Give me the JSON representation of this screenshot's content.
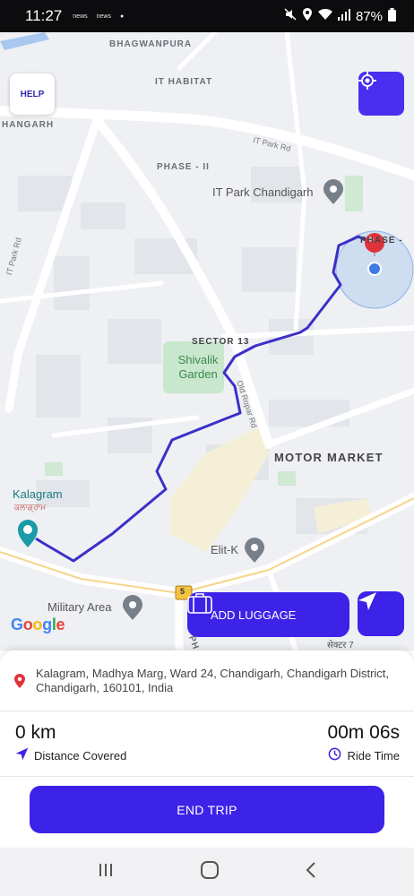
{
  "status_bar": {
    "time": "11:27",
    "notifications": [
      "news",
      "news"
    ],
    "battery": "87%"
  },
  "map": {
    "labels": {
      "bhagwanpura": "BHAGWANPURA",
      "it_habitat": "IT HABITAT",
      "hangarh": "HANGARH",
      "phase_ii": "PHASE - II",
      "it_park_rd_top": "IT Park Rd",
      "it_park_chandigarh": "IT Park Chandigarh",
      "it_park_rd_left": "IT Park Rd",
      "phase_right": "PHASE -",
      "sector_13": "SECTOR 13",
      "shivalik_garden": "Shivalik Garden",
      "old_ropar_rd": "Old Ropar Rd",
      "motor_market": "MOTOR MARKET",
      "kalagram": "Kalagram",
      "kalagram_local": "ਕਲਾਗ੍ਰਾਮ",
      "elit_k": "Elit-K",
      "military_area": "Military Area",
      "road_number": "5",
      "sector_7": "सेक्टर 7",
      "road_partial": "PH"
    },
    "google_logo": "Google"
  },
  "buttons": {
    "help": "HELP",
    "add_luggage": "ADD LUGGAGE",
    "end_trip": "END TRIP"
  },
  "trip": {
    "address": "Kalagram, Madhya Marg, Ward 24, Chandigarh, Chandigarh District, Chandigarh, 160101, India",
    "distance_value": "0 km",
    "distance_label": "Distance Covered",
    "time_value": "00m 06s",
    "time_label": "Ride Time"
  },
  "colors": {
    "accent": "#3d22e8",
    "route": "#3b2fc9",
    "marker": "#e0323c"
  },
  "icons": [
    "locate-icon",
    "luggage-icon",
    "navigation-arrow-icon",
    "location-pin-icon",
    "clock-icon",
    "recents-icon",
    "home-icon",
    "back-icon"
  ]
}
